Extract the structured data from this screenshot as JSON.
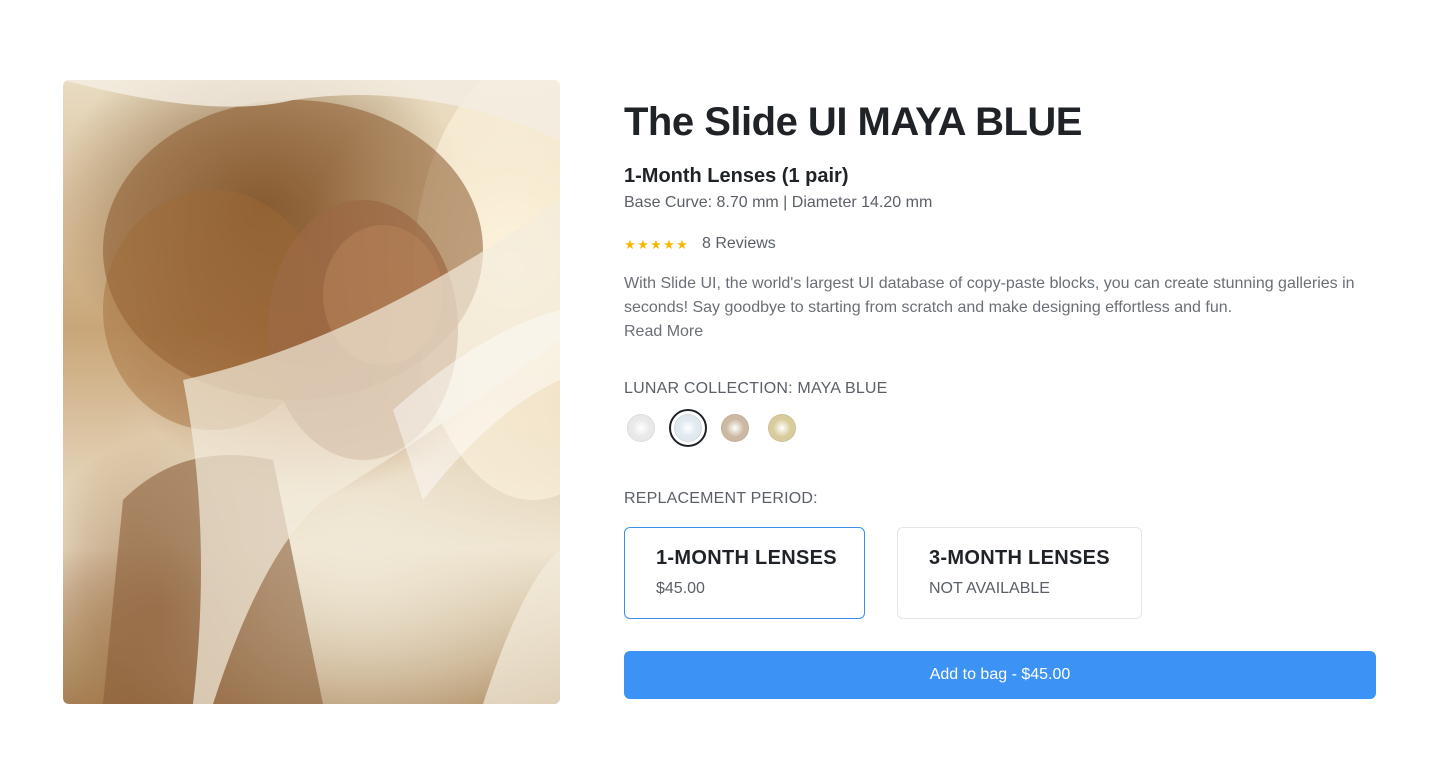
{
  "product": {
    "title": "The Slide UI MAYA BLUE",
    "subtitle": "1-Month Lenses (1 pair)",
    "specs": "Base Curve: 8.70 mm | Diameter 14.20 mm",
    "rating": {
      "stars": 5,
      "reviews_label": "8 Reviews",
      "star_glyph": "★",
      "star_color": "#f5b800"
    },
    "description": "With Slide UI, the world's largest UI database of copy-paste blocks, you can create stunning galleries in seconds! Say goodbye to starting from scratch and make designing effortless and fun.",
    "read_more": "Read More",
    "image_icon": "portrait-photo"
  },
  "collection": {
    "label": "LUNAR COLLECTION: MAYA BLUE",
    "swatches": [
      {
        "name": "clear",
        "color": "#e9e9ea",
        "selected": false
      },
      {
        "name": "maya-blue",
        "color": "#dfe9ef",
        "selected": true
      },
      {
        "name": "hazel",
        "color": "#cdb9a3",
        "selected": false
      },
      {
        "name": "gold",
        "color": "#d8cc9c",
        "selected": false
      }
    ]
  },
  "replacement": {
    "label": "REPLACEMENT PERIOD:",
    "options": [
      {
        "title": "1-MONTH LENSES",
        "sub": "$45.00",
        "selected": true
      },
      {
        "title": "3-MONTH LENSES",
        "sub": "NOT AVAILABLE",
        "selected": false
      }
    ]
  },
  "cta": {
    "label": "Add to bag - $45.00",
    "color": "#3d93f5"
  },
  "colors": {
    "selected_border": "#3b8fe6",
    "text_primary": "#1f2328",
    "text_muted": "#5b6068"
  }
}
